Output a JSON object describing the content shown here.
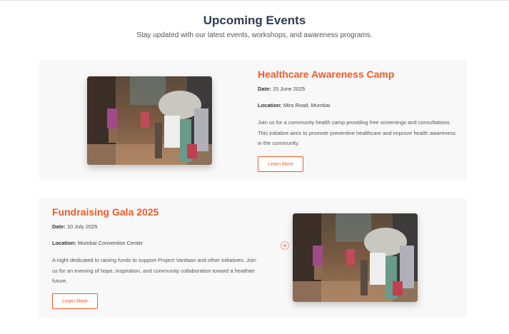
{
  "header": {
    "title": "Upcoming Events",
    "subtitle": "Stay updated with our latest events, workshops, and awareness programs."
  },
  "events": [
    {
      "title": "Healthcare Awareness Camp",
      "date_label": "Date:",
      "date": "15 June 2025",
      "location_label": "Location:",
      "location": "Mira Road, Mumbai",
      "description": "Join us for a community health camp providing free screenings and consultations. This initiative aims to promote preventive healthcare and improve health awareness in the community.",
      "button": "Learn More"
    },
    {
      "title": "Fundraising Gala 2025",
      "date_label": "Date:",
      "date": "10 July 2025",
      "location_label": "Location:",
      "location": "Mumbai Convention Center",
      "description": "A night dedicated to raising funds to support Project Vardaan and other initiatives. Join us for an evening of hope, inspiration, and community collaboration toward a healthier future.",
      "button": "Learn More"
    }
  ],
  "colors": {
    "accent": "#f05a28",
    "heading": "#2d3b4e",
    "card_bg": "#f8f8f8"
  },
  "icons": {
    "carousel_indicator": "circle-dot-icon"
  }
}
